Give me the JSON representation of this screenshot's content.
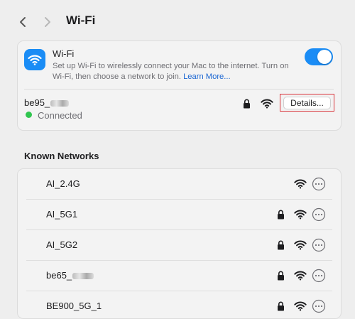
{
  "header": {
    "title": "Wi-Fi",
    "back_icon": "chevron-left-icon",
    "forward_icon": "chevron-right-icon"
  },
  "wifi_card": {
    "label": "Wi-Fi",
    "description": "Set up Wi-Fi to wirelessly connect your Mac to the internet. Turn on Wi-Fi, then choose a network to join.",
    "learn_more": "Learn More...",
    "toggle_on": true,
    "accent_color": "#1a8cf5",
    "current_network": {
      "name": "be95_",
      "status": "Connected",
      "status_color": "#30c54f",
      "details_button": "Details..."
    }
  },
  "known_networks": {
    "heading": "Known Networks",
    "items": [
      {
        "name": "AI_2.4G",
        "locked": false
      },
      {
        "name": "AI_5G1",
        "locked": true
      },
      {
        "name": "AI_5G2",
        "locked": true
      },
      {
        "name": "be65_",
        "locked": true
      },
      {
        "name": "BE900_5G_1",
        "locked": true
      }
    ]
  },
  "annotation": {
    "highlight_color": "#d9343a"
  }
}
